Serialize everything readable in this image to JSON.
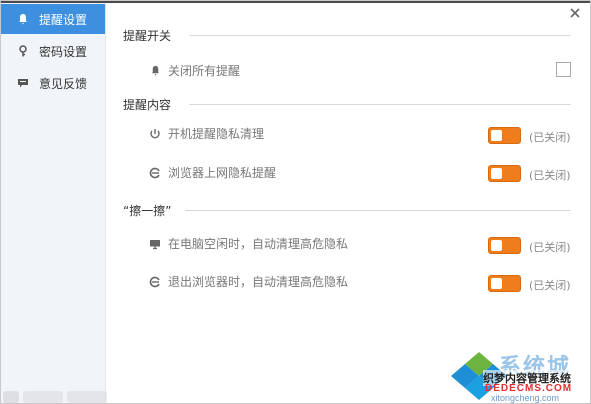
{
  "sidebar": {
    "items": [
      {
        "label": "提醒设置",
        "icon": "bell-icon",
        "active": true
      },
      {
        "label": "密码设置",
        "icon": "key-icon",
        "active": false
      },
      {
        "label": "意见反馈",
        "icon": "feedback-icon",
        "active": false
      }
    ]
  },
  "sections": {
    "switch_all": {
      "title": "提醒开关",
      "row": {
        "label": "关闭所有提醒",
        "icon": "bell-icon",
        "checked": false
      }
    },
    "content": {
      "title": "提醒内容",
      "rows": [
        {
          "label": "开机提醒隐私清理",
          "icon": "power-icon",
          "status": "(已关闭)"
        },
        {
          "label": "浏览器上网隐私提醒",
          "icon": "browser-icon",
          "status": "(已关闭)"
        }
      ]
    },
    "wipe": {
      "title": "“擦一擦”",
      "rows": [
        {
          "label": "在电脑空闲时，自动清理高危隐私",
          "icon": "monitor-icon",
          "status": "(已关闭)"
        },
        {
          "label": "退出浏览器时，自动清理高危隐私",
          "icon": "browser-icon",
          "status": "(已关闭)"
        }
      ]
    }
  },
  "watermark": {
    "brand": "系统城",
    "site1": "织梦内容管理系统",
    "site2": "DEDECMS.COM",
    "url": "xitongcheng.com"
  },
  "colors": {
    "accent": "#3d8fe0",
    "toggle": "#f07d1b"
  }
}
